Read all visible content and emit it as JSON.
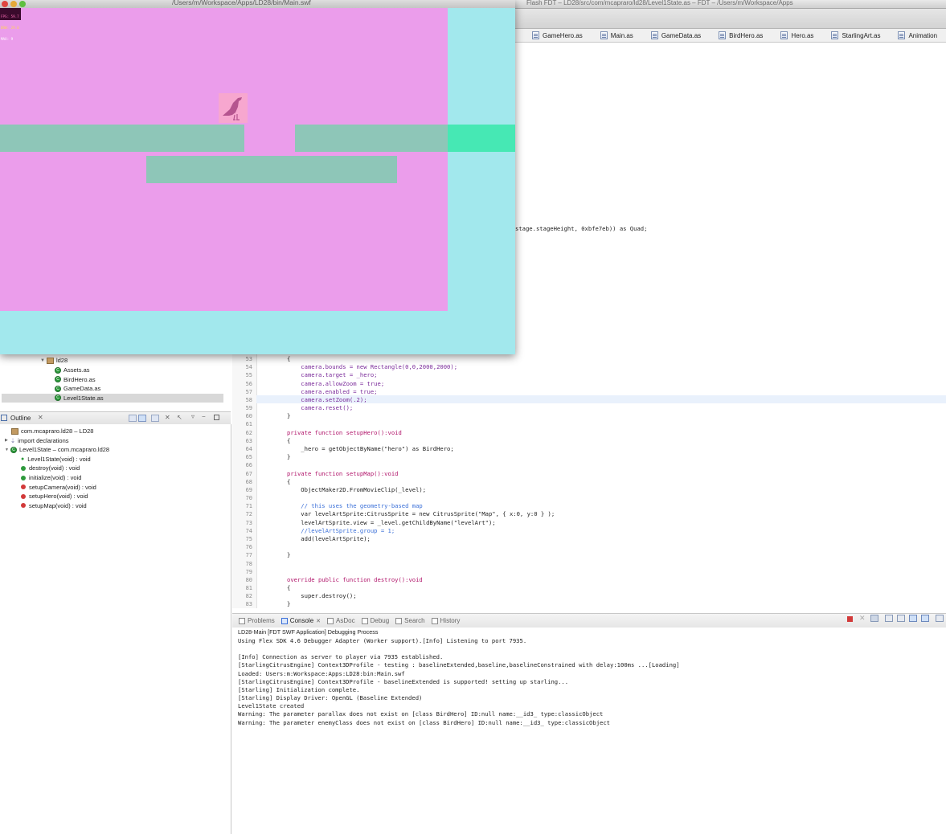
{
  "ide": {
    "window_title": "Flash FDT – LD28/src/com/mcapraro/ld28/Level1State.as – FDT – /Users/m/Workspace/Apps",
    "editor_tabs": [
      "GameHero.as",
      "Main.as",
      "GameData.as",
      "BirdHero.as",
      "Hero.as",
      "StarlingArt.as",
      "Animation"
    ],
    "partial_code_line": "stage.stageHeight, 0xbfe7eb)) as Quad;"
  },
  "package_tree": {
    "package": "ld28",
    "files": [
      "Assets.as",
      "BirdHero.as",
      "GameData.as",
      "Level1State.as"
    ],
    "selected": "Level1State.as"
  },
  "outline": {
    "title": "Outline",
    "items": [
      {
        "label": "com.mcapraro.ld28 – LD28",
        "indent": 1
      },
      {
        "label": "import declarations",
        "indent": 1
      },
      {
        "label": "Level1State – com.mcapraro.ld28",
        "indent": 0
      },
      {
        "label": "Level1State(void) : void",
        "indent": 2
      },
      {
        "label": "destroy(void) : void",
        "indent": 2
      },
      {
        "label": "initialize(void) : void",
        "indent": 2
      },
      {
        "label": "setupCamera(void) : void",
        "indent": 2
      },
      {
        "label": "setupHero(void) : void",
        "indent": 2
      },
      {
        "label": "setupMap(void) : void",
        "indent": 2
      }
    ]
  },
  "code": {
    "lines": [
      {
        "n": "53",
        "t": "{"
      },
      {
        "n": "54",
        "t": "    camera.bounds = new Rectangle(0,0,2000,2000);"
      },
      {
        "n": "55",
        "t": "    camera.target = _hero;"
      },
      {
        "n": "56",
        "t": "    camera.allowZoom = true;"
      },
      {
        "n": "57",
        "t": "    camera.enabled = true;"
      },
      {
        "n": "58",
        "t": "    camera.setZoom(.2);"
      },
      {
        "n": "59",
        "t": "    camera.reset();"
      },
      {
        "n": "60",
        "t": "}"
      },
      {
        "n": "61",
        "t": ""
      },
      {
        "n": "62",
        "t": "private function setupHero():void"
      },
      {
        "n": "63",
        "t": "{"
      },
      {
        "n": "64",
        "t": "    _hero = getObjectByName(\"hero\") as BirdHero;"
      },
      {
        "n": "65",
        "t": "}"
      },
      {
        "n": "66",
        "t": ""
      },
      {
        "n": "67",
        "t": "private function setupMap():void"
      },
      {
        "n": "68",
        "t": "{"
      },
      {
        "n": "69",
        "t": "    ObjectMaker2D.FromMovieClip(_level);"
      },
      {
        "n": "70",
        "t": ""
      },
      {
        "n": "71",
        "t": "    // this uses the geometry-based map"
      },
      {
        "n": "72",
        "t": "    var levelArtSprite:CitrusSprite = new CitrusSprite(\"Map\", { x:0, y:0 } );"
      },
      {
        "n": "73",
        "t": "    levelArtSprite.view = _level.getChildByName(\"levelArt\");"
      },
      {
        "n": "74",
        "t": "    //levelArtSprite.group = 1;"
      },
      {
        "n": "75",
        "t": "    add(levelArtSprite);"
      },
      {
        "n": "76",
        "t": ""
      },
      {
        "n": "77",
        "t": "}"
      },
      {
        "n": "78",
        "t": ""
      },
      {
        "n": "79",
        "t": ""
      },
      {
        "n": "80",
        "t": "override public function destroy():void"
      },
      {
        "n": "81",
        "t": "{"
      },
      {
        "n": "82",
        "t": "    super.destroy();"
      },
      {
        "n": "83",
        "t": "}"
      }
    ]
  },
  "console": {
    "tabs": [
      "Problems",
      "Console",
      "AsDoc",
      "Debug",
      "Search",
      "History"
    ],
    "active_tab": "Console",
    "process": "LD28-Main [FDT SWF Application] Debugging Process",
    "lines": [
      "Using Flex SDK 4.6 Debugger Adapter (Worker support).[Info] Listening to port 7935.",
      "",
      "[Info] Connection as server to player via 7935 established.",
      "[StarlingCitrusEngine] Context3DProfile - testing : baselineExtended,baseline,baselineConstrained with delay:100ms ...[Loading]",
      "Loaded: Users:m:Workspace:Apps:LD28:bin:Main.swf",
      "[StarlingCitrusEngine] Context3DProfile - baselineExtended is supported! setting up starling...",
      "[Starling] Initialization complete.",
      "[Starling] Display Driver: OpenGL (Baseline Extended)",
      "Level1State created",
      "Warning: The parameter parallax does not exist on [class BirdHero] ID:null name:__id3_ type:classicObject",
      "Warning: The parameter enemyClass does not exist on [class BirdHero] ID:null name:__id3_ type:classicObject"
    ]
  },
  "flash_player": {
    "title": "/Users/m/Workspace/Apps/LD28/bin/Main.swf",
    "stats": [
      "FPS: 59.7",
      "DRW: 29.0",
      "MAX: 9"
    ],
    "colors": {
      "background": "#a2e8ed",
      "level": "#eb9deb",
      "platform": "#8ec6b8",
      "platform_bright": "#46e8b4",
      "bird_box": "#f7a7cf",
      "bird": "#b5548f"
    }
  }
}
